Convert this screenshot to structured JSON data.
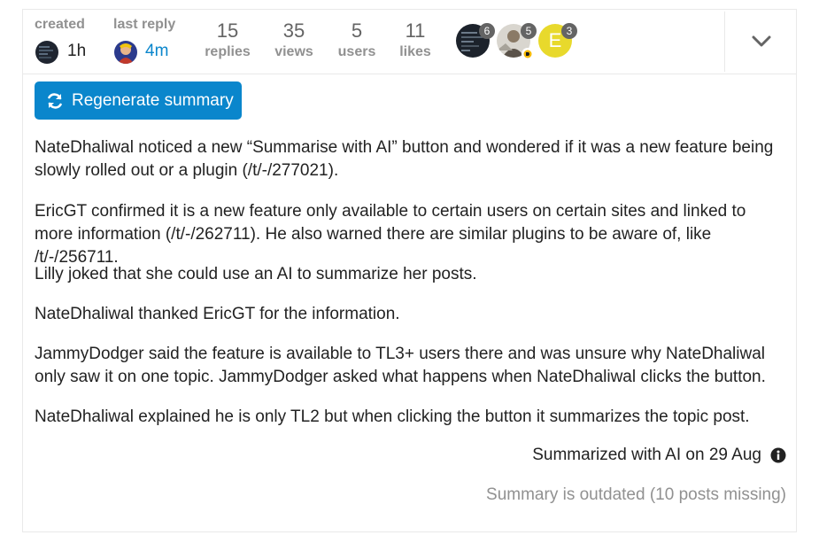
{
  "colors": {
    "accent": "#0a86cc",
    "muted": "#919191",
    "text": "#222222",
    "border": "#e9e9e9",
    "stat_number": "#646464",
    "avatar_e_bg": "#e8d92c",
    "avatar_badge_bg": "#646464"
  },
  "topic_map": {
    "created_label": "created",
    "created_time": "1h",
    "last_reply_label": "last reply",
    "last_reply_time": "4m",
    "stats": [
      {
        "number": "15",
        "label": "replies"
      },
      {
        "number": "35",
        "label": "views"
      },
      {
        "number": "5",
        "label": "users"
      },
      {
        "number": "11",
        "label": "likes"
      }
    ],
    "participants": [
      {
        "count": "6",
        "avatar": "dark-screen-avatar"
      },
      {
        "count": "5",
        "avatar": "photo-avatar"
      },
      {
        "count": "3",
        "avatar": "letter-avatar",
        "letter": "E"
      }
    ],
    "toggle_icon": "chevron-down-icon"
  },
  "summary": {
    "regenerate_label": "Regenerate summary",
    "regenerate_icon": "refresh-icon",
    "paragraphs": [
      "NateDhaliwal noticed a new “Summarise with AI” button and wondered if it was a new feature being slowly rolled out or a plugin (/t/-/277021).",
      "EricGT confirmed it is a new feature only available to certain users on certain sites and linked to more information (/t/-/262711). He also warned there are similar plugins to be aware of, like /t/-/256711.",
      "Lilly joked that she could use an AI to summarize her posts.",
      "NateDhaliwal thanked EricGT for the information.",
      "JammyDodger said the feature is available to TL3+ users there and was unsure why NateDhaliwal only saw it on one topic. JammyDodger asked what happens when NateDhaliwal clicks the button.",
      "NateDhaliwal explained he is only TL2 but when clicking the button it summarizes the topic post."
    ],
    "summarized_with": "Summarized with AI on 29 Aug",
    "info_icon": "info-icon",
    "outdated": "Summary is outdated (10 posts missing)"
  }
}
